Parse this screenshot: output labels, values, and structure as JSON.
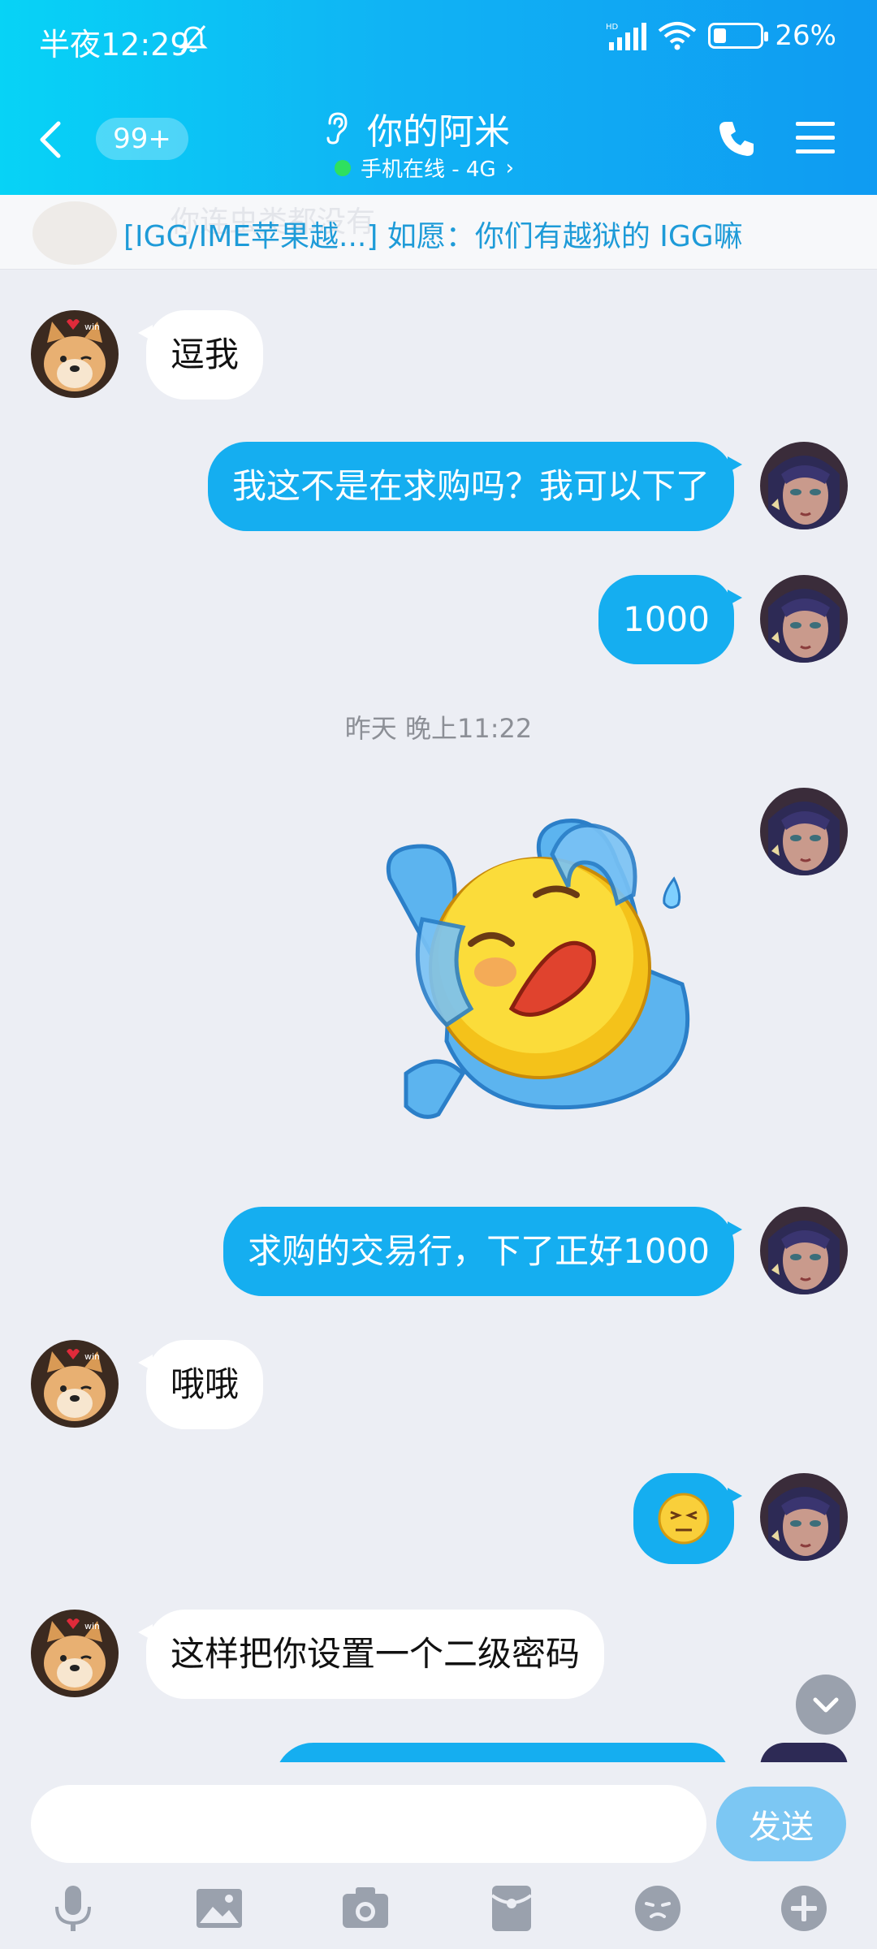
{
  "status_bar": {
    "time": "半夜12:29",
    "battery": "26%",
    "battery_level": 0.26
  },
  "header": {
    "unread_badge": "99+",
    "title": "你的阿米",
    "presence": "手机在线 - 4G",
    "presence_chevron": "›"
  },
  "notice": {
    "ghost_text": "你连虫类都没有",
    "text": "[IGG/IME苹果越...] 如愿：你们有越狱的   IGG嘛"
  },
  "messages": [
    {
      "side": "in",
      "text": "逗我"
    },
    {
      "side": "out",
      "text": "我这不是在求购吗？我可以下了"
    },
    {
      "side": "out",
      "text": "1000"
    },
    {
      "side": "out",
      "type": "sticker",
      "icon": "tired-face-sticker"
    },
    {
      "side": "out",
      "text": "求购的交易行，下了正好1000"
    },
    {
      "side": "in",
      "text": "哦哦"
    },
    {
      "side": "out",
      "type": "emoji",
      "icon": "grumpy-face-emoji"
    },
    {
      "side": "in",
      "text": "这样把你设置一个二级密码"
    }
  ],
  "timestamp": "昨天  晚上11:22",
  "input": {
    "placeholder": "",
    "value": ""
  },
  "send_label": "发送",
  "toolbar": [
    "microphone-icon",
    "image-icon",
    "camera-icon",
    "red-packet-icon",
    "emoji-icon",
    "plus-icon"
  ],
  "colors": {
    "header_start": "#07d3f6",
    "header_end": "#0f9bf2",
    "bubble_out": "#15aef0",
    "bubble_in": "#ffffff",
    "notice_text": "#1e9bd8",
    "send_button": "#7cc7f3"
  }
}
